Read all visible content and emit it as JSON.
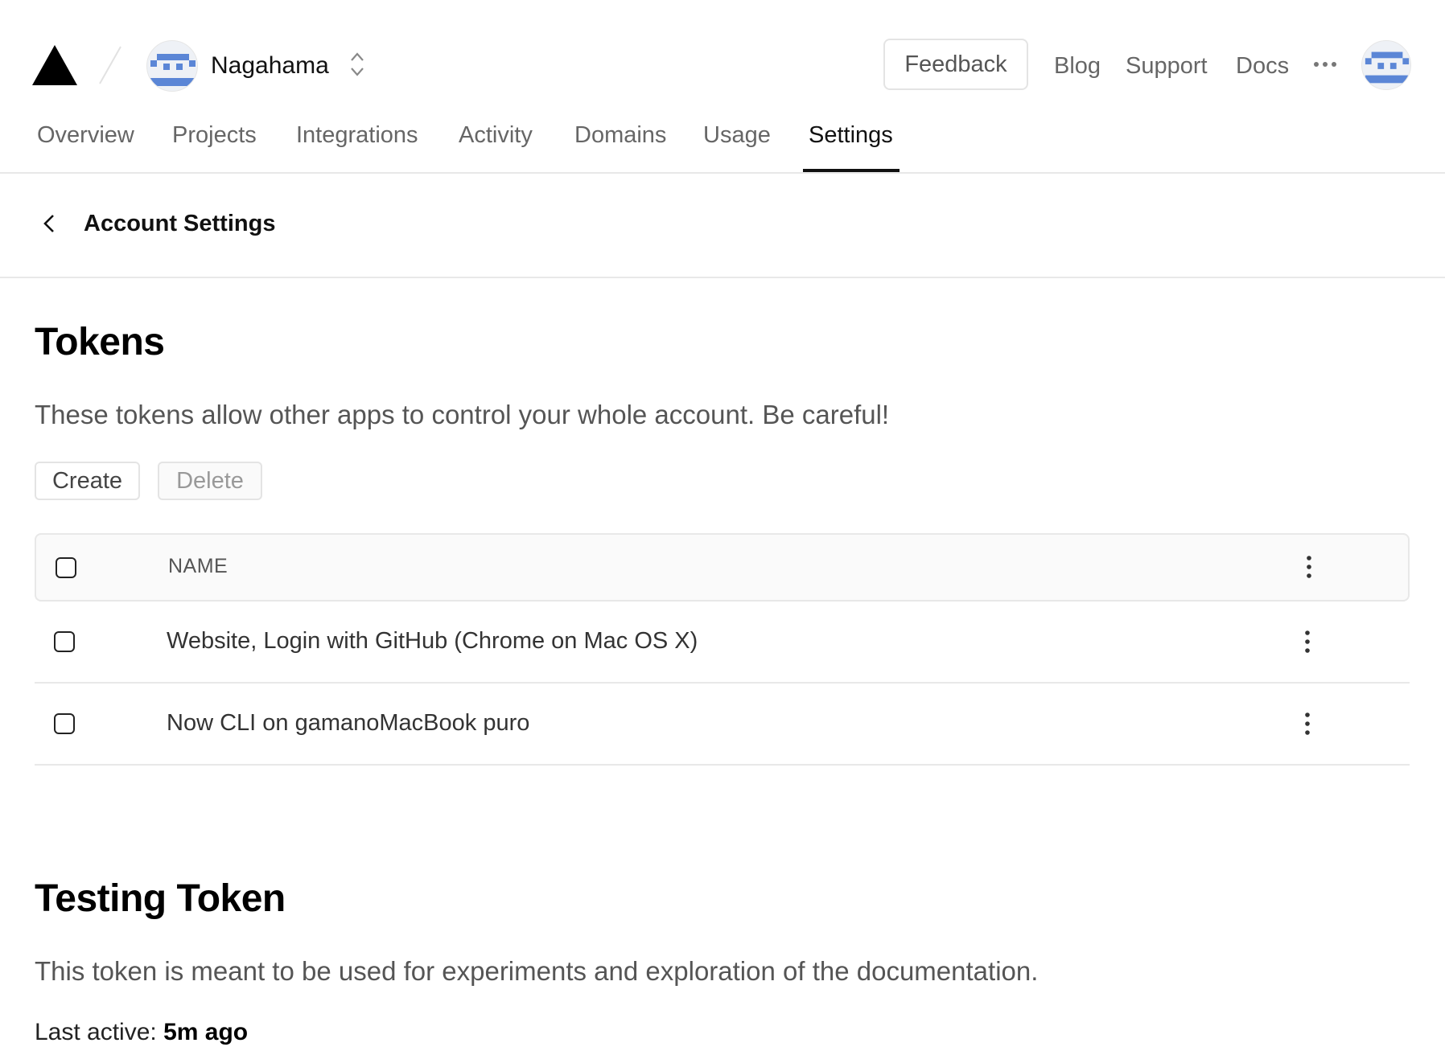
{
  "header": {
    "team_name": "Nagahama",
    "feedback_label": "Feedback",
    "links": [
      "Blog",
      "Support",
      "Docs"
    ],
    "avatar_color": "#5b86d6"
  },
  "tabs": [
    {
      "label": "Overview"
    },
    {
      "label": "Projects"
    },
    {
      "label": "Integrations"
    },
    {
      "label": "Activity"
    },
    {
      "label": "Domains"
    },
    {
      "label": "Usage"
    },
    {
      "label": "Settings",
      "active": true
    }
  ],
  "breadcrumb": {
    "title": "Account Settings"
  },
  "tokens": {
    "heading": "Tokens",
    "description": "These tokens allow other apps to control your whole account. Be careful!",
    "create_label": "Create",
    "delete_label": "Delete",
    "table": {
      "header": "NAME",
      "rows": [
        {
          "name": "Website, Login with GitHub (Chrome on Mac OS X)"
        },
        {
          "name": "Now CLI on gamanoMacBook puro"
        }
      ]
    }
  },
  "testing_token": {
    "heading": "Testing Token",
    "description": "This token is meant to be used for experiments and exploration of the documentation.",
    "last_active_label": "Last active:",
    "last_active_value": "5m ago"
  }
}
